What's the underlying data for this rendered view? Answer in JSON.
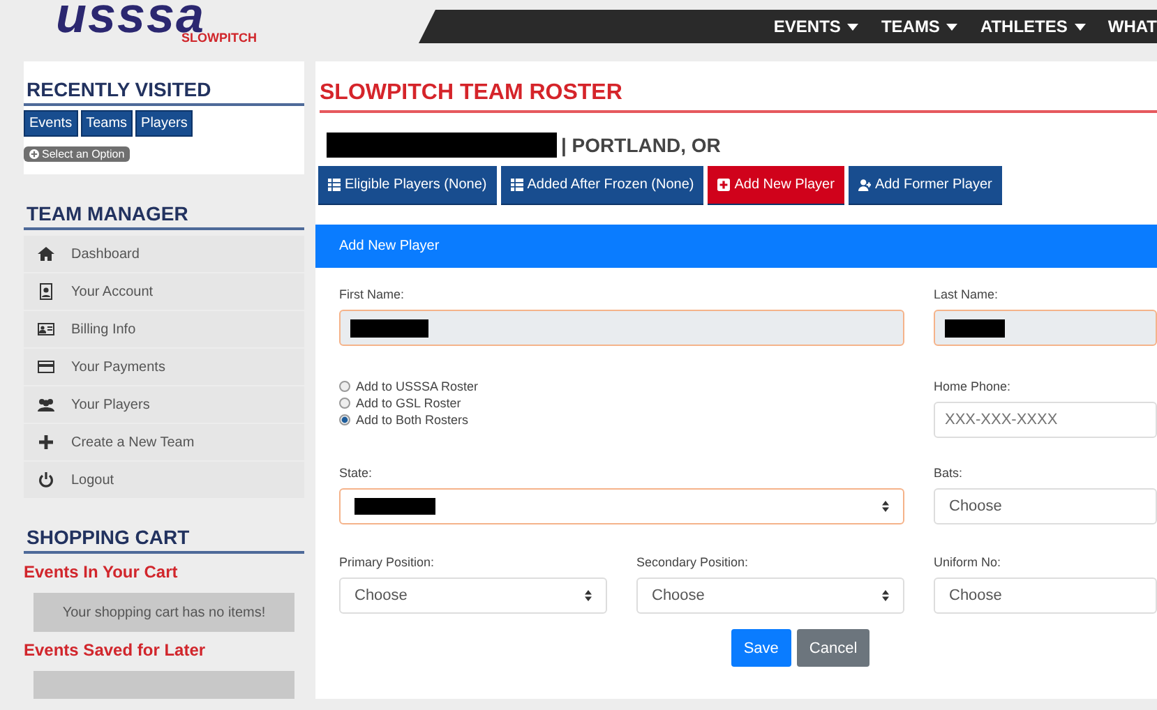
{
  "header": {
    "logo": {
      "word": "usssa",
      "sub": "SLOWPITCH"
    },
    "nav": [
      {
        "label": "EVENTS",
        "caret": true
      },
      {
        "label": "TEAMS",
        "caret": true
      },
      {
        "label": "ATHLETES",
        "caret": true
      },
      {
        "label": "WHAT",
        "caret": false
      }
    ]
  },
  "sidebar": {
    "recent": {
      "title": "RECENTLY VISITED",
      "buttons": [
        "Events",
        "Teams",
        "Players"
      ],
      "select": "Select an Option"
    },
    "manager": {
      "title": "TEAM MANAGER",
      "items": [
        "Dashboard",
        "Your Account",
        "Billing Info",
        "Your Payments",
        "Your Players",
        "Create a New Team",
        "Logout"
      ]
    },
    "cart": {
      "title": "SHOPPING CART",
      "in_cart": "Events In Your Cart",
      "empty": "Your shopping cart has no items!",
      "saved": "Events Saved for Later"
    }
  },
  "main": {
    "title": "SLOWPITCH TEAM ROSTER",
    "team": {
      "name_redacted": true,
      "location": "| PORTLAND, OR"
    },
    "tabs": [
      {
        "label": "Eligible Players (None)",
        "selected": false
      },
      {
        "label": "Added After Frozen (None)",
        "selected": false
      },
      {
        "label": "Add New Player",
        "selected": true
      },
      {
        "label": "Add Former Player",
        "selected": false
      }
    ],
    "panel": {
      "title": "Add New Player",
      "first_name": {
        "label": "First Name:",
        "redacted": true,
        "highlighted": true
      },
      "last_name": {
        "label": "Last Name:",
        "redacted": true,
        "highlighted": true
      },
      "rosters": [
        {
          "label": "Add to USSSA Roster",
          "selected": false
        },
        {
          "label": "Add to GSL Roster",
          "selected": false
        },
        {
          "label": "Add to Both Rosters",
          "selected": true
        }
      ],
      "home_phone": {
        "label": "Home Phone:",
        "placeholder": "XXX-XXX-XXXX"
      },
      "state": {
        "label": "State:",
        "redacted": true,
        "highlighted": true
      },
      "bats": {
        "label": "Bats:",
        "value": "Choose"
      },
      "primary": {
        "label": "Primary Position:",
        "value": "Choose"
      },
      "secondary": {
        "label": "Secondary Position:",
        "value": "Choose"
      },
      "uniform": {
        "label": "Uniform No:",
        "value": "Choose"
      },
      "buttons": [
        {
          "label": "Save",
          "kind": "primary"
        },
        {
          "label": "Cancel",
          "kind": "secondary"
        }
      ]
    }
  }
}
